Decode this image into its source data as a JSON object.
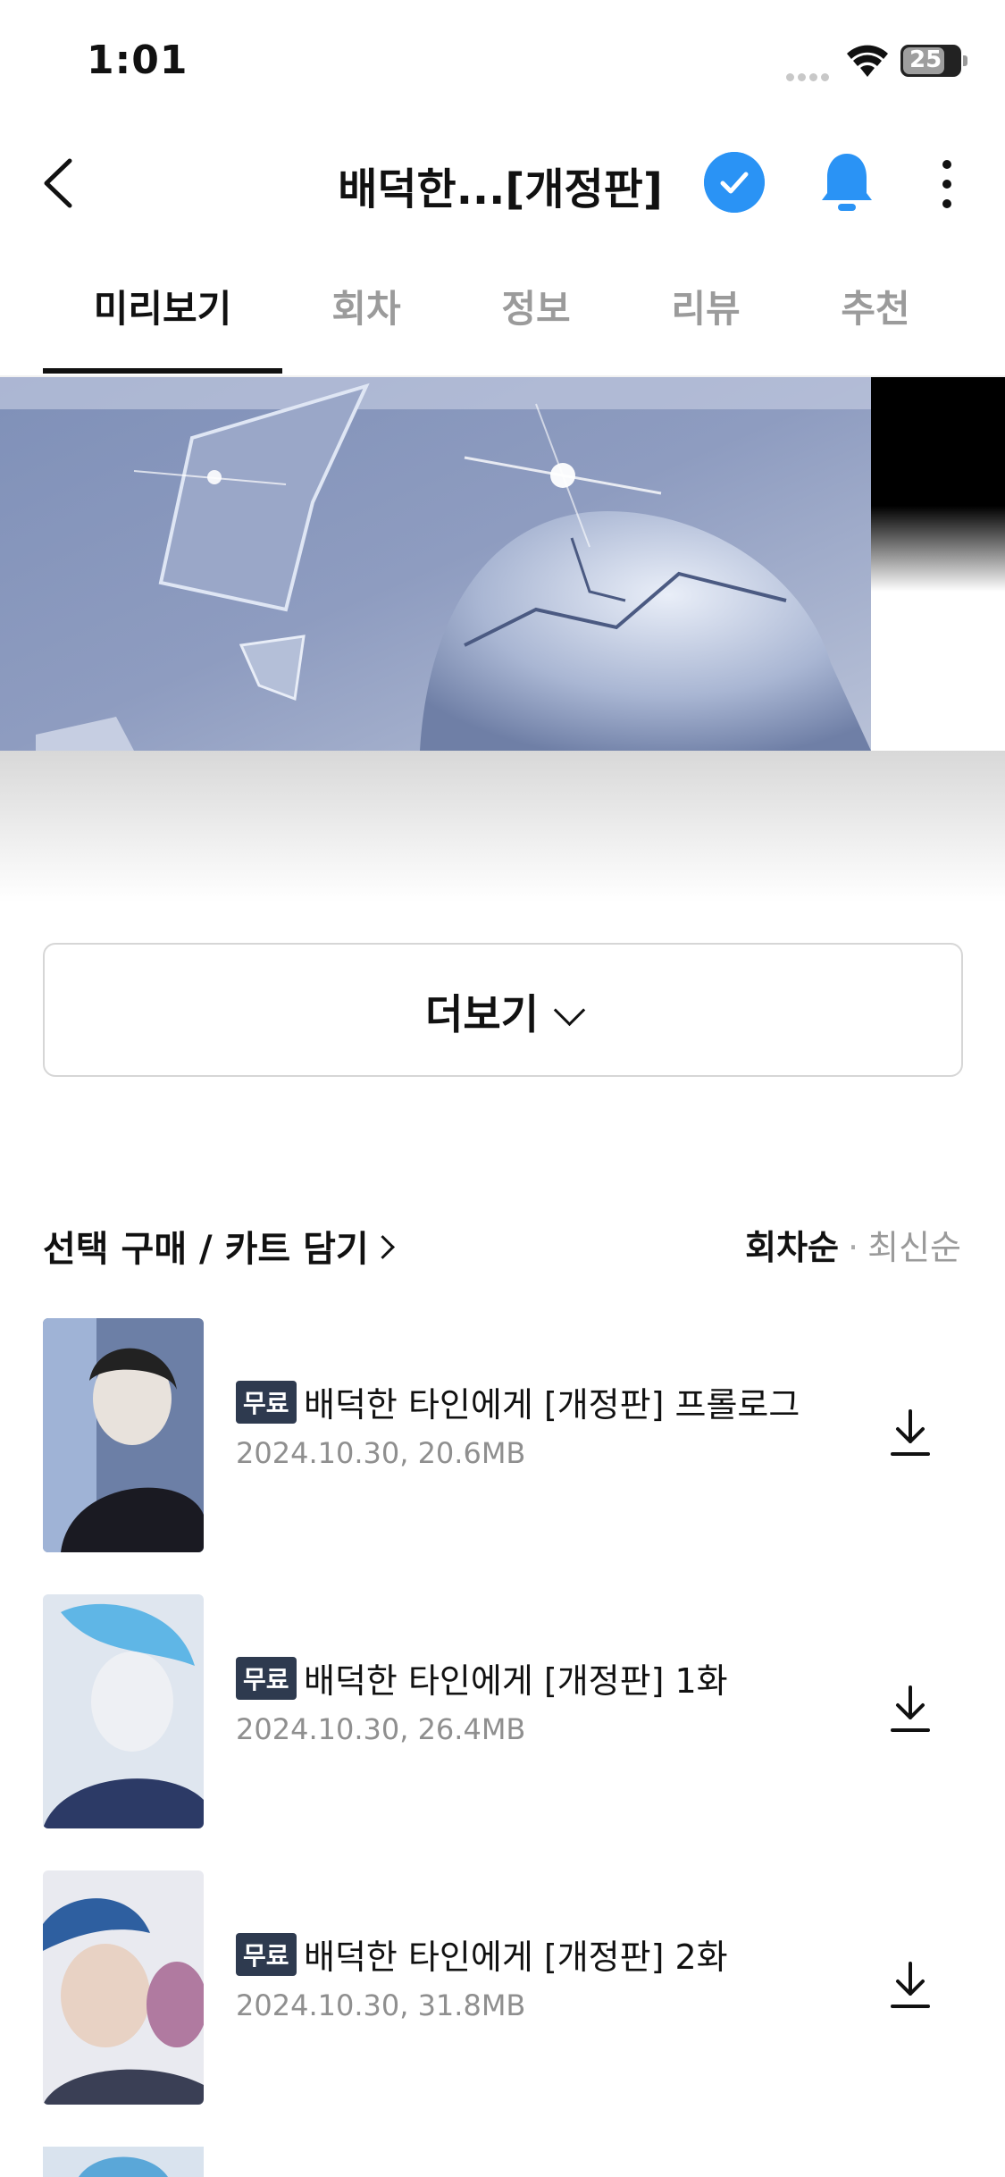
{
  "status_bar": {
    "time": "1:01",
    "battery": "25"
  },
  "nav": {
    "title": "배덕한...[개정판]"
  },
  "tabs": [
    {
      "label": "미리보기",
      "active": true
    },
    {
      "label": "회차",
      "active": false
    },
    {
      "label": "정보",
      "active": false
    },
    {
      "label": "리뷰",
      "active": false
    },
    {
      "label": "추천",
      "active": false
    }
  ],
  "more_button": {
    "label": "더보기"
  },
  "list_header": {
    "select_label": "선택 구매 / 카트 담기",
    "sort_active": "회차순",
    "sort_separator": "·",
    "sort_inactive": "최신순"
  },
  "episodes": [
    {
      "badge": "무료",
      "title": "배덕한 타인에게 [개정판] 프롤로그",
      "meta": "2024.10.30, 20.6MB"
    },
    {
      "badge": "무료",
      "title": "배덕한 타인에게 [개정판] 1화",
      "meta": "2024.10.30, 26.4MB"
    },
    {
      "badge": "무료",
      "title": "배덕한 타인에게 [개정판] 2화",
      "meta": "2024.10.30, 31.8MB"
    }
  ],
  "icons": {
    "back": "chevron-left-icon",
    "check": "check-circle-icon",
    "bell": "bell-icon",
    "more": "more-vertical-icon",
    "download": "download-icon"
  },
  "colors": {
    "accent": "#2a93f5",
    "badge": "#2e3a4f",
    "muted": "#9b9b9b"
  }
}
